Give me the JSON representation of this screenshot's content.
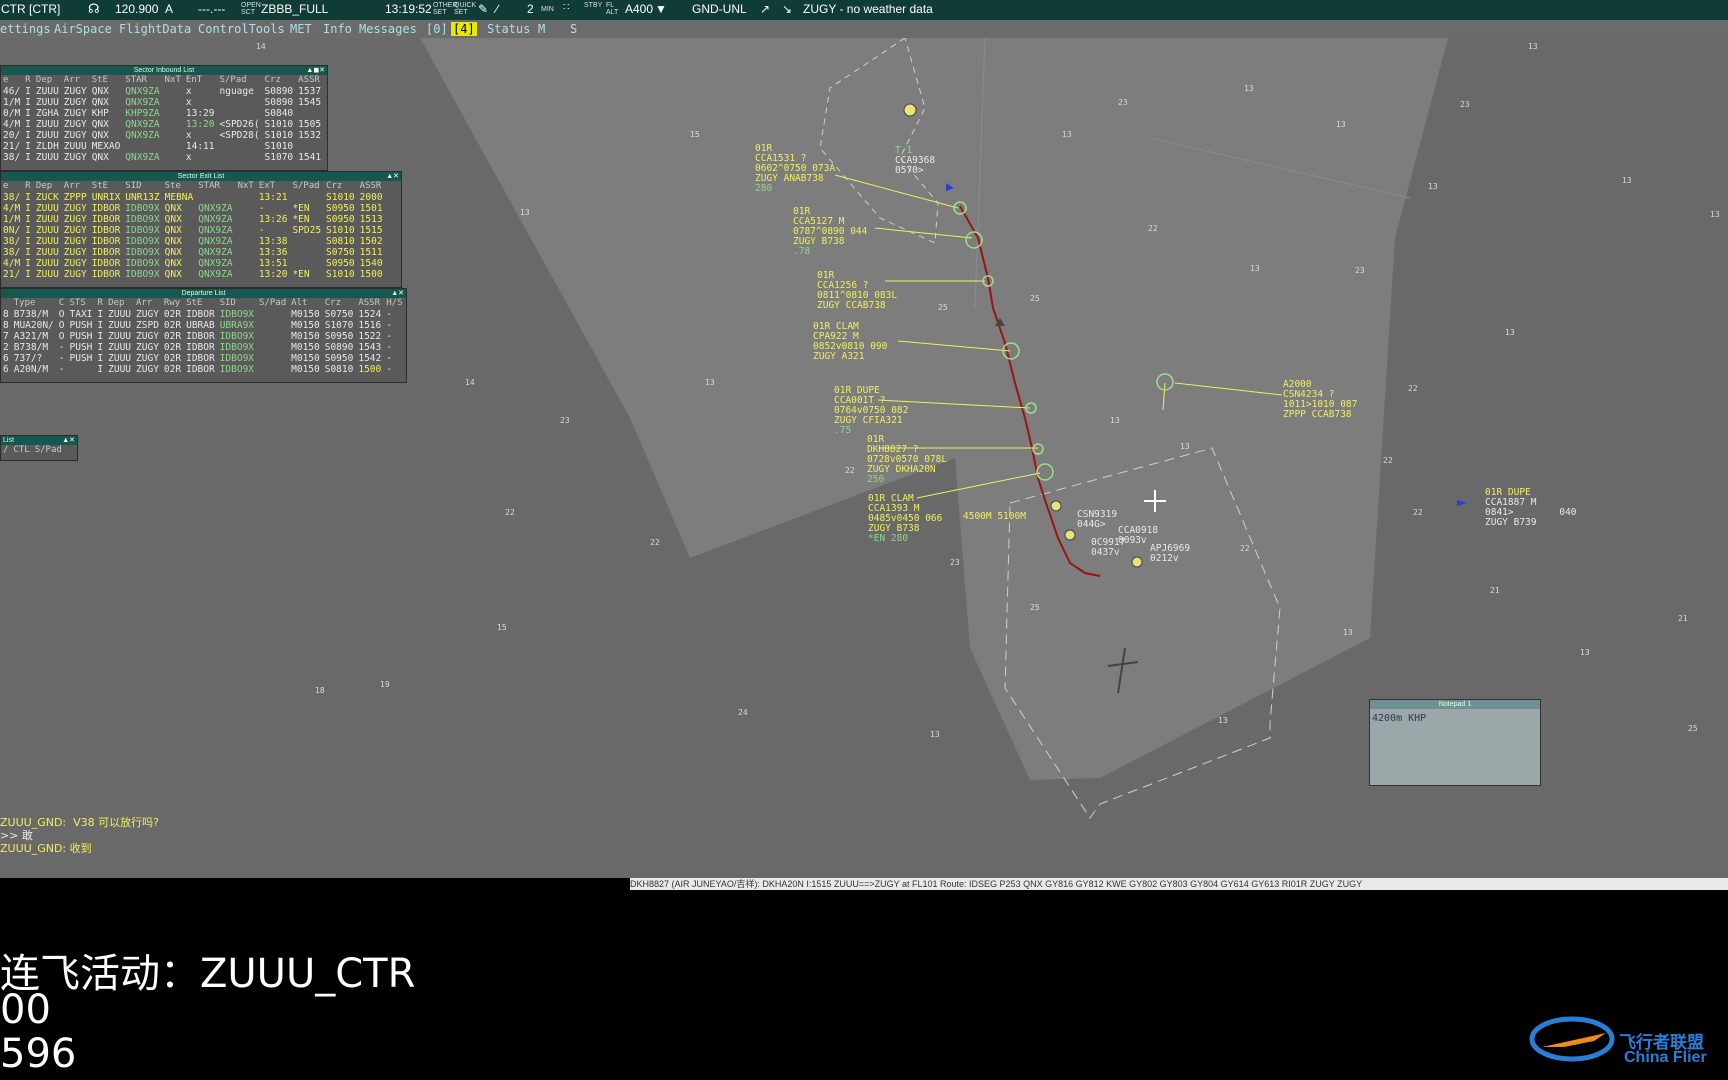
{
  "topbar": {
    "callsign": "CTR [CTR]",
    "frequency": "120.900",
    "mode": "A",
    "dashes": "---.---",
    "open_sct": "OPEN\nSCT",
    "sector_file": "ZBBB_FULL",
    "time": "13:19:52",
    "other_set": "OTHER\nSET",
    "quick_set": "QUICK\nSET",
    "min_value": "2",
    "min_label": "MIN",
    "stby_label": "STBY",
    "fl_alt_label": "FL\nALT",
    "altitude": "A400",
    "level_filter": "GND-UNL",
    "weather": "ZUGY - no weather data"
  },
  "menubar": {
    "settings": "ettings",
    "airspace": "AirSpace",
    "flightdata": "FlightData",
    "controltools": "ControlTools",
    "met": "MET",
    "info": "Info",
    "messages": "Messages",
    "msg_count0": "[0]",
    "msg_count4": "[4]",
    "status": "Status",
    "m": "M",
    "s": "S"
  },
  "inbound_list": {
    "title": "Sector Inbound List",
    "headers": [
      "e",
      "R",
      "Dep",
      "Arr",
      "StE",
      "STAR",
      "NxT",
      "EnT",
      "S/Pad",
      "Crz",
      "ASSR"
    ],
    "rows": [
      [
        "46/",
        "I",
        "ZUUU",
        "ZUGY",
        "QNX",
        "QNX9ZA",
        "",
        "x",
        "nguage",
        "S0890",
        "1537"
      ],
      [
        "1/M",
        "I",
        "ZUUU",
        "ZUGY",
        "QNX",
        "QNX9ZA",
        "",
        "x",
        "",
        "S0890",
        "1545"
      ],
      [
        "0/M",
        "I",
        "ZGHA",
        "ZUGY",
        "KHP",
        "KHP9ZA",
        "",
        "13:29",
        "",
        "S0840",
        ""
      ],
      [
        "4/M",
        "I",
        "ZUUU",
        "ZUGY",
        "QNX",
        "QNX9ZA",
        "",
        "13:20",
        "<SPD26(",
        "S1010",
        "1505"
      ],
      [
        "20/",
        "I",
        "ZUUU",
        "ZUGY",
        "QNX",
        "QNX9ZA",
        "",
        "x",
        "<SPD28(",
        "S1010",
        "1532"
      ],
      [
        "21/",
        "I",
        "ZLDH",
        "ZUUU",
        "MEXAO",
        "",
        "",
        "14:11",
        "",
        "S1010",
        ""
      ],
      [
        "38/",
        "I",
        "ZUUU",
        "ZUGY",
        "QNX",
        "QNX9ZA",
        "",
        "x",
        "",
        "S1070",
        "1541"
      ]
    ]
  },
  "exit_list": {
    "title": "Sector Exit List",
    "headers": [
      "e",
      "R",
      "Dep",
      "Arr",
      "StE",
      "SID",
      "Ste",
      "STAR",
      "NxT",
      "ExT",
      "S/Pad",
      "Crz",
      "ASSR"
    ],
    "rows": [
      [
        "38/",
        "I",
        "ZUCK",
        "ZPPP",
        "UNRIX",
        "UNR13Z",
        "MEBNA",
        "",
        "",
        "13:21",
        "",
        "S1010",
        "2000"
      ],
      [
        "4/M",
        "I",
        "ZUUU",
        "ZUGY",
        "IDBOR",
        "IDBO9X",
        "QNX",
        "QNX9ZA",
        "",
        "-",
        "*EN",
        "S0950",
        "1501"
      ],
      [
        "1/M",
        "I",
        "ZUUU",
        "ZUGY",
        "IDBOR",
        "IDBO9X",
        "QNX",
        "QNX9ZA",
        "",
        "13:26",
        "*EN",
        "S0950",
        "1513"
      ],
      [
        "0N/",
        "I",
        "ZUUU",
        "ZUGY",
        "IDBOR",
        "IDBO9X",
        "QNX",
        "QNX9ZA",
        "",
        "-",
        "SPD25",
        "S1010",
        "1515"
      ],
      [
        "38/",
        "I",
        "ZUUU",
        "ZUGY",
        "IDBOR",
        "IDBO9X",
        "QNX",
        "QNX9ZA",
        "",
        "13:38",
        "",
        "S0810",
        "1502"
      ],
      [
        "38/",
        "I",
        "ZUUU",
        "ZUGY",
        "IDBOR",
        "IDBO9X",
        "QNX",
        "QNX9ZA",
        "",
        "13:36",
        "",
        "S0750",
        "1511"
      ],
      [
        "4/M",
        "I",
        "ZUUU",
        "ZUGY",
        "IDBOR",
        "IDBO9X",
        "QNX",
        "QNX9ZA",
        "",
        "13:51",
        "",
        "S0950",
        "1540"
      ],
      [
        "21/",
        "I",
        "ZUUU",
        "ZUGY",
        "IDBOR",
        "IDBO9X",
        "QNX",
        "QNX9ZA",
        "",
        "13:20",
        "*EN",
        "S1010",
        "1500"
      ]
    ]
  },
  "departure_list": {
    "title": "Departure List",
    "headers": [
      "",
      "Type",
      "C",
      "STS",
      "R",
      "Dep",
      "Arr",
      "Rwy",
      "StE",
      "SID",
      "S/Pad",
      "Alt",
      "Crz",
      "ASSR",
      "H/S"
    ],
    "rows": [
      [
        "8",
        "B738/M",
        "O",
        "TAXI",
        "I",
        "ZUUU",
        "ZUGY",
        "02R",
        "IDBOR",
        "IDBO9X",
        "",
        "M0150",
        "S0750",
        "1524",
        "-"
      ],
      [
        "8",
        "MUA20N/",
        "O",
        "PUSH",
        "I",
        "ZUUU",
        "ZSPD",
        "02R",
        "UBRAB",
        "UBRA9X",
        "",
        "M0150",
        "S1070",
        "1516",
        "-"
      ],
      [
        "7",
        "A321/M",
        "O",
        "PUSH",
        "I",
        "ZUUU",
        "ZUGY",
        "02R",
        "IDBOR",
        "IDBO9X",
        "",
        "M0150",
        "S0950",
        "1522",
        "-"
      ],
      [
        "2",
        "B738/M",
        "-",
        "PUSH",
        "I",
        "ZUUU",
        "ZUGY",
        "02R",
        "IDBOR",
        "IDBO9X",
        "",
        "M0150",
        "S0890",
        "1543",
        "-"
      ],
      [
        "6",
        "737/?",
        "-",
        "PUSH",
        "I",
        "ZUUU",
        "ZUGY",
        "02R",
        "IDBOR",
        "IDBO9X",
        "",
        "M0150",
        "S0950",
        "1542",
        "-"
      ],
      [
        "6",
        "A20N/M",
        "-",
        "",
        "I",
        "ZUUU",
        "ZUGY",
        "02R",
        "IDBOR",
        "IDBO9X",
        "",
        "M0150",
        "S0810",
        "1500",
        "-"
      ]
    ]
  },
  "small_list": {
    "title": "List",
    "headers": [
      "/",
      "CTL",
      "S/Pad"
    ]
  },
  "targets": [
    {
      "lines": [
        "01R",
        "CCA1531 ?",
        "0602^0750 073A",
        "ZUGY ANAB738",
        "280"
      ]
    },
    {
      "lines": [
        "T-1",
        "CCA9368",
        "0570>"
      ]
    },
    {
      "lines": [
        "01R",
        "CCA5127 M",
        "0787^0890 044",
        "ZUGY B738",
        ".78"
      ]
    },
    {
      "lines": [
        "01R",
        "CCA1256 ?",
        "0811^0810 083L",
        "ZUGY CCAB738"
      ]
    },
    {
      "lines": [
        "01R CLAM",
        "CPA922 M",
        "0852v0810 090",
        "ZUGY A321"
      ]
    },
    {
      "lines": [
        "01R DUPE",
        "CCA001T ?",
        "0764v0750 082",
        "ZUGY CFIA321",
        ".75"
      ]
    },
    {
      "lines": [
        "01R",
        "DKH8827 ?",
        "0728v0570 078L",
        "ZUGY DKHA20N",
        "250"
      ]
    },
    {
      "lines": [
        "01R CLAM",
        "CCA1393 M",
        "0485v0450 066",
        "ZUGY B738",
        "*EN 280"
      ]
    },
    {
      "lines": [
        "4500M 5100M"
      ]
    },
    {
      "lines": [
        "CSN9319",
        "044G>"
      ]
    },
    {
      "lines": [
        "CCA0918",
        "0093v"
      ]
    },
    {
      "lines": [
        "0C9917",
        "0437v"
      ]
    },
    {
      "lines": [
        "APJ6969",
        "0212v"
      ]
    },
    {
      "lines": [
        "A2000",
        "CSN4234 ?",
        "1011>1010 087",
        "ZPPP CCAB738"
      ]
    },
    {
      "lines": [
        "01R DUPE",
        "CCA1887 M",
        "0841>        040",
        "ZUGY B739"
      ]
    }
  ],
  "chat": {
    "line1": "ZUUU_GND:  V38 可以放行吗?",
    "line2": ">> 敢",
    "line3": "ZUUU_GND: 收到"
  },
  "status_line": "DKH8827 (AIR JUNEYAO/吉祥): DKHA20N I:1515 ZUUU==>ZUGY at FL101 Route: IDSEG P253 QNX GY816 GY812 KWE GY802 GY803 GY804 GY614 GY613 RI01R ZUGY ZUGY",
  "overlay": {
    "line1": "连飞活动：ZUUU_CTR",
    "line2": "00",
    "line3": "596"
  },
  "notepad": {
    "title": "Notepad 1",
    "text": "4200m KHP"
  },
  "logo": {
    "cn": "飞行者联盟",
    "en": "China Flier"
  },
  "colors": {
    "radar_bg": "#696969",
    "sector_light": "#7f7f7f",
    "tag_yellow": "#f2ef5a",
    "route_red": "#a01818",
    "titlebar": "#16584e"
  }
}
